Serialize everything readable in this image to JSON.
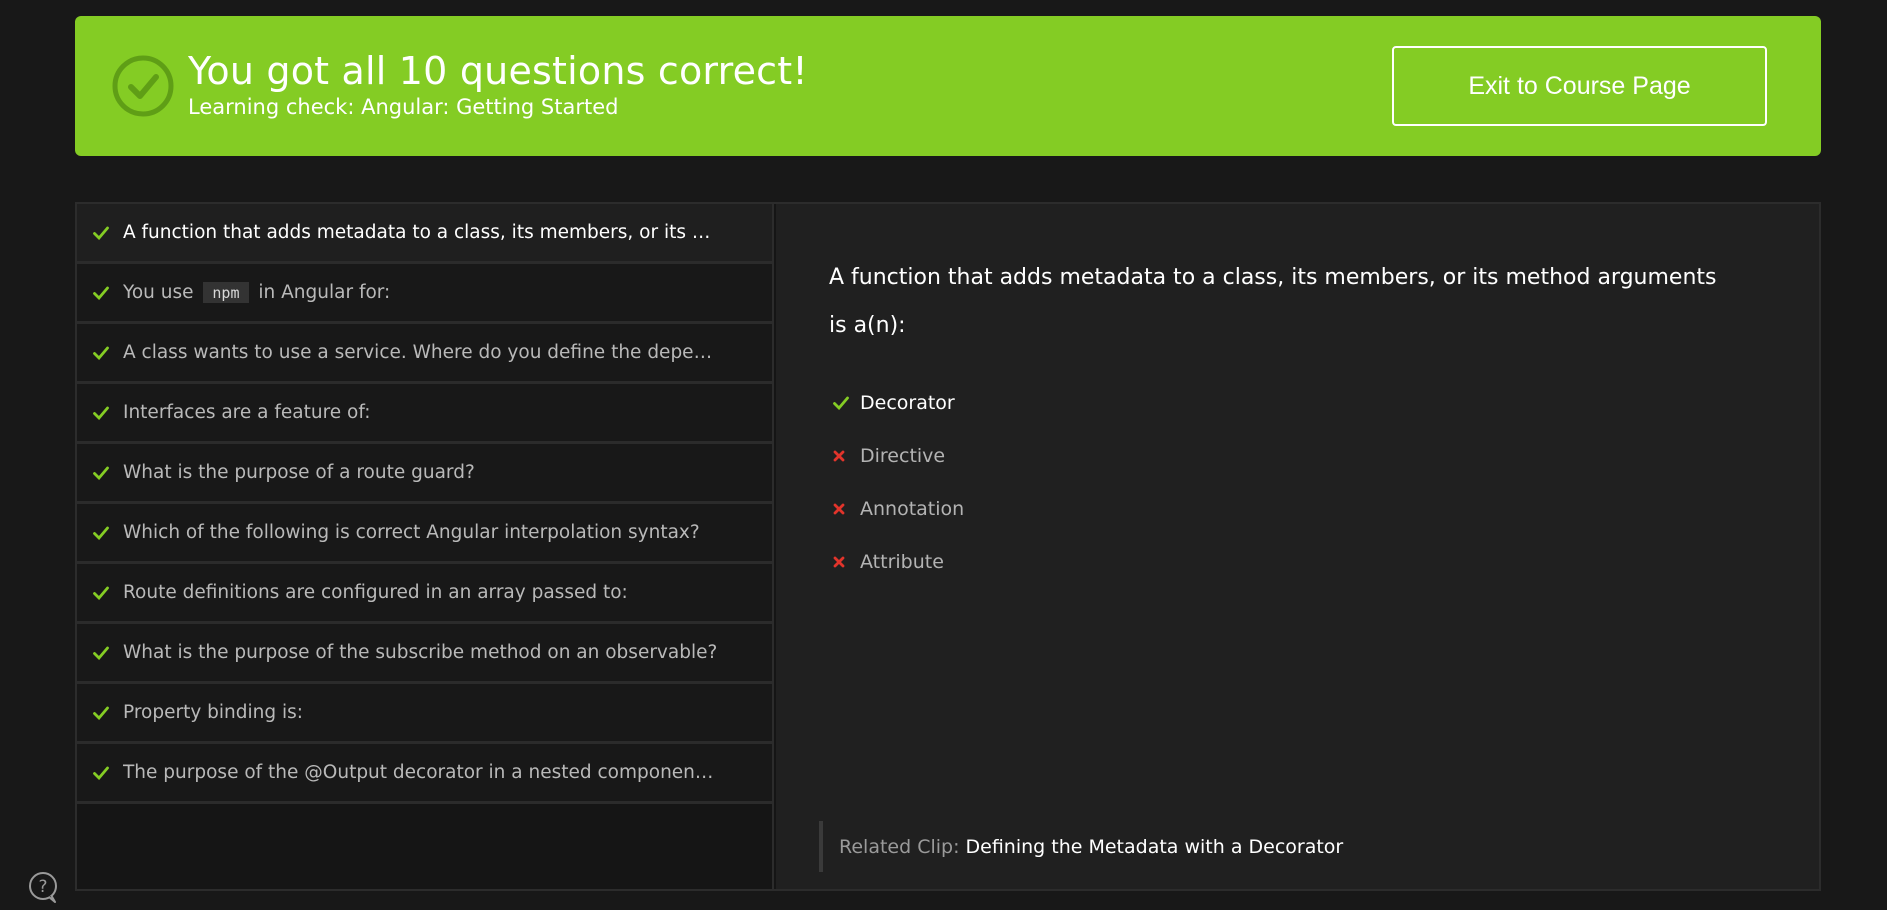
{
  "banner": {
    "title": "You got all 10 questions correct!",
    "subtitle": "Learning check: Angular: Getting Started",
    "exit_label": "Exit to Course Page",
    "color": "#84cc24"
  },
  "questions": [
    {
      "text": "A function that adds metadata to a class, its members, or its me...",
      "status": "correct",
      "active": true
    },
    {
      "prefix": "You use",
      "code": "npm",
      "suffix": "in Angular for:",
      "status": "correct"
    },
    {
      "text": "A class wants to use a service. Where do you define the depend...",
      "status": "correct"
    },
    {
      "text": "Interfaces are a feature of:",
      "status": "correct"
    },
    {
      "text": "What is the purpose of a route guard?",
      "status": "correct"
    },
    {
      "text": "Which of the following is correct Angular interpolation syntax?",
      "status": "correct"
    },
    {
      "text": "Route definitions are configured in an array passed to:",
      "status": "correct"
    },
    {
      "text": "What is the purpose of the subscribe method on an observable?",
      "status": "correct"
    },
    {
      "text": "Property binding is:",
      "status": "correct"
    },
    {
      "text": "The purpose of the @Output decorator in a nested component i...",
      "status": "correct"
    }
  ],
  "detail": {
    "question": "A function that adds metadata to a class, its members, or its method arguments is a(n):",
    "answers": [
      {
        "label": "Decorator",
        "correct": true
      },
      {
        "label": "Directive",
        "correct": false
      },
      {
        "label": "Annotation",
        "correct": false
      },
      {
        "label": "Attribute",
        "correct": false
      }
    ],
    "related_label": "Related Clip:",
    "related_clip": "Defining the Metadata with a Decorator"
  },
  "icons": {
    "check": "check-icon",
    "cross": "cross-icon",
    "help": "help-icon",
    "check_color": "#84cc24",
    "cross_color": "#e2342b"
  }
}
